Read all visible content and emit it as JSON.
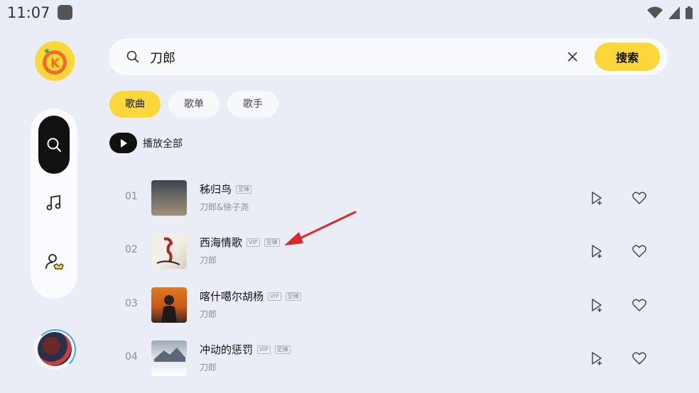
{
  "status_bar": {
    "time": "11:07"
  },
  "search": {
    "query": "刀郎",
    "button_label": "搜索"
  },
  "tabs": [
    {
      "label": "歌曲",
      "active": true
    },
    {
      "label": "歌单",
      "active": false
    },
    {
      "label": "歌手",
      "active": false
    }
  ],
  "play_all_label": "播放全部",
  "songs": [
    {
      "index": "01",
      "title": "秭归鸟",
      "badges": [
        "至臻"
      ],
      "artist": "刀郎&徐子尧"
    },
    {
      "index": "02",
      "title": "西海情歌",
      "badges": [
        "VIP",
        "至臻"
      ],
      "artist": "刀郎"
    },
    {
      "index": "03",
      "title": "喀什噶尔胡杨",
      "badges": [
        "VIP",
        "至臻"
      ],
      "artist": "刀郎"
    },
    {
      "index": "04",
      "title": "冲动的惩罚",
      "badges": [
        "VIP",
        "至臻"
      ],
      "artist": "刀郎"
    }
  ],
  "colors": {
    "accent": "#fbd73a",
    "background": "#ebedf6",
    "annotation_arrow": "#d92b2b"
  },
  "icons": {
    "sidebar": [
      "search-icon",
      "music-note-icon",
      "user-vip-icon"
    ],
    "row_actions": [
      "add-to-playlist-icon",
      "heart-icon"
    ]
  }
}
